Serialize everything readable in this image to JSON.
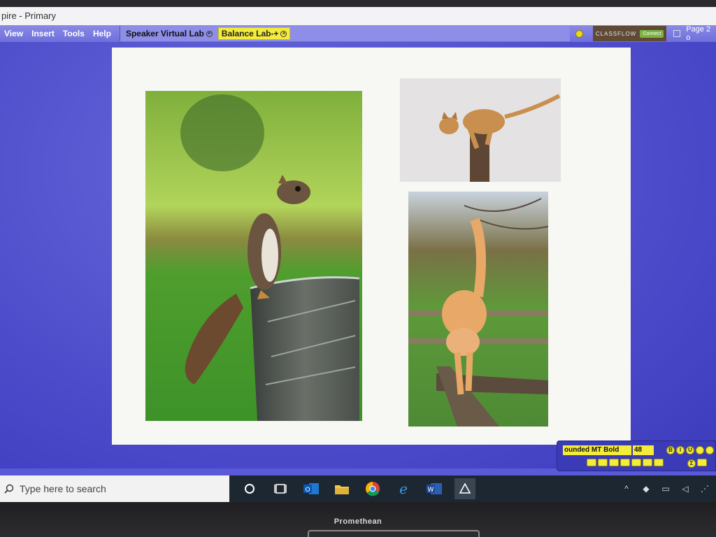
{
  "window": {
    "title": "pire - Primary"
  },
  "menu": {
    "items": [
      "View",
      "Insert",
      "Tools",
      "Help"
    ],
    "tabs": [
      {
        "label": "Speaker Virtual Lab"
      },
      {
        "label": "Balance Lab-+"
      }
    ],
    "classflow_logo": "CLASSFLOW",
    "connect_label": "Connect",
    "page_indicator": "Page 2 o"
  },
  "canvas": {
    "photos": [
      {
        "subject": "squirrel standing on metal bucket"
      },
      {
        "subject": "cat crouching on wooden post"
      },
      {
        "subject": "cat walking on fence rail"
      }
    ]
  },
  "font_toolbar": {
    "font_name": "ounded MT Bold",
    "font_size": "48",
    "colors": {
      "yellow": "#f4ec3a",
      "panel": "#3b3bb8"
    }
  },
  "taskbar": {
    "search_placeholder": "Type here to search",
    "icons": [
      "cortana-icon",
      "task-view-icon",
      "outlook-icon",
      "file-explorer-icon",
      "chrome-icon",
      "edge-icon",
      "word-icon",
      "activinspire-icon"
    ]
  },
  "monitor": {
    "brand": "Promethean"
  }
}
